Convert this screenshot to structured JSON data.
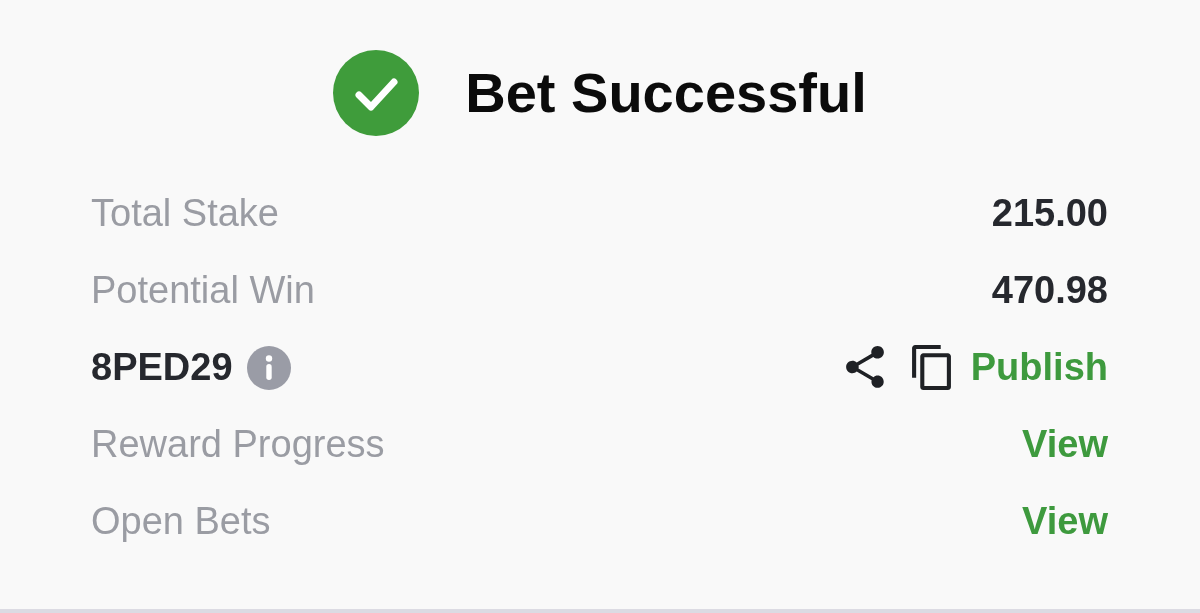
{
  "header": {
    "title": "Bet Successful"
  },
  "rows": [
    {
      "kind": "amount",
      "label": "Total Stake",
      "value": "215.00"
    },
    {
      "kind": "amount",
      "label": "Potential Win",
      "value": "470.98"
    },
    {
      "kind": "code",
      "code": "8PED29",
      "action": "Publish"
    },
    {
      "kind": "link",
      "label": "Reward Progress",
      "action": "View"
    },
    {
      "kind": "link",
      "label": "Open Bets",
      "action": "View"
    }
  ]
}
